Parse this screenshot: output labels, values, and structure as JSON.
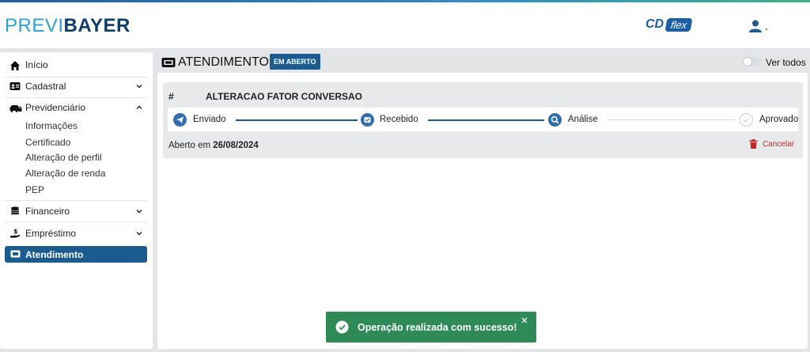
{
  "header": {
    "logo_prefix": "PREVI",
    "logo_suffix": "BAYER",
    "cd_label": "CD",
    "flex_label": "flex"
  },
  "sidebar": {
    "inicio": "Início",
    "cadastral": "Cadastral",
    "previdenciario": "Previdenciário",
    "previdenciario_items": [
      "Informações",
      "Certificado",
      "Alteração de perfil",
      "Alteração de renda",
      "PEP"
    ],
    "financeiro": "Financeiro",
    "emprestimo": "Empréstimo",
    "atendimento": "Atendimento"
  },
  "main": {
    "title": "ATENDIMENTO",
    "status_badge": "EM ABERTO",
    "ver_todos": "Ver todos",
    "card": {
      "hash": "#",
      "title": "ALTERACAO FATOR CONVERSAO",
      "steps": [
        {
          "label": "Enviado",
          "done": true
        },
        {
          "label": "Recebido",
          "done": true
        },
        {
          "label": "Análise",
          "done": true
        },
        {
          "label": "Aprovado",
          "done": false
        }
      ],
      "opened_prefix": "Aberto em",
      "opened_date": "26/08/2024",
      "cancel_label": "Cancelar"
    }
  },
  "toast": {
    "message": "Operação realizada com sucesso!"
  },
  "colors": {
    "primary": "#1a5c8f",
    "success": "#2e8b57",
    "danger": "#c62828"
  }
}
